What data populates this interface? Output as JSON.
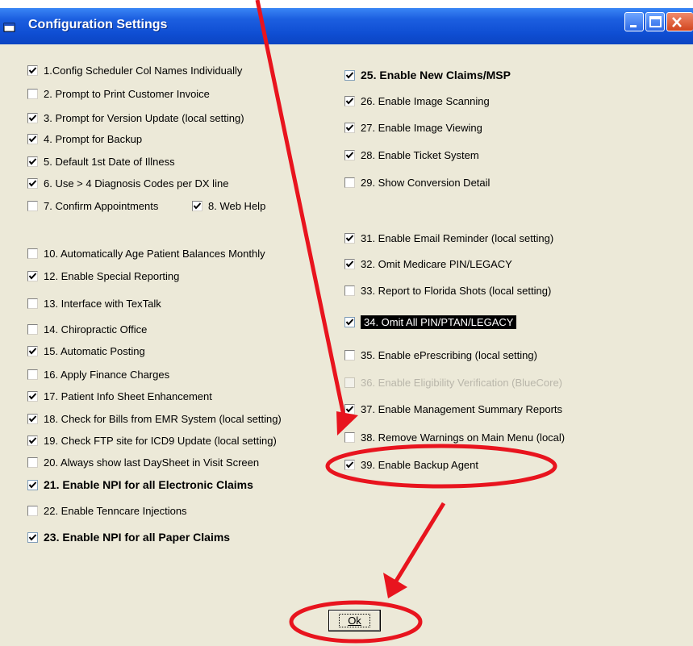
{
  "window": {
    "title": "Configuration Settings"
  },
  "options": [
    {
      "id": "o1",
      "label": "1.Config Scheduler Col Names Individually",
      "checked": true
    },
    {
      "id": "o2",
      "label": "2. Prompt to Print Customer Invoice",
      "checked": false
    },
    {
      "id": "o3",
      "label": "3. Prompt for Version Update (local setting)",
      "checked": true
    },
    {
      "id": "o4",
      "label": "4. Prompt for Backup",
      "checked": true
    },
    {
      "id": "o5",
      "label": "5. Default 1st Date of Illness",
      "checked": true
    },
    {
      "id": "o6",
      "label": "6. Use > 4 Diagnosis Codes per DX line",
      "checked": true
    },
    {
      "id": "o7",
      "label": "7. Confirm Appointments",
      "checked": false
    },
    {
      "id": "o8",
      "label": "8. Web Help",
      "checked": true
    },
    {
      "id": "o10",
      "label": "10. Automatically Age Patient Balances Monthly",
      "checked": false
    },
    {
      "id": "o12",
      "label": "12.  Enable Special Reporting",
      "checked": true
    },
    {
      "id": "o13",
      "label": "13. Interface with TexTalk",
      "checked": false
    },
    {
      "id": "o14",
      "label": "14. Chiropractic Office",
      "checked": false
    },
    {
      "id": "o15",
      "label": "15. Automatic Posting",
      "checked": true
    },
    {
      "id": "o16",
      "label": "16. Apply Finance Charges",
      "checked": false
    },
    {
      "id": "o17",
      "label": "17. Patient Info Sheet Enhancement",
      "checked": true
    },
    {
      "id": "o18",
      "label": "18. Check for  Bills from EMR System (local setting)",
      "checked": true
    },
    {
      "id": "o19",
      "label": "19. Check FTP site for ICD9 Update (local setting)",
      "checked": true
    },
    {
      "id": "o20",
      "label": "20. Always show last DaySheet in Visit Screen",
      "checked": false
    },
    {
      "id": "o21",
      "label": "21.  Enable NPI for all Electronic Claims",
      "checked": true
    },
    {
      "id": "o22",
      "label": "22.  Enable Tenncare Injections",
      "checked": false
    },
    {
      "id": "o23",
      "label": "23.  Enable NPI for all Paper Claims",
      "checked": true
    },
    {
      "id": "o25",
      "label": "25.  Enable New Claims/MSP",
      "checked": true
    },
    {
      "id": "o26",
      "label": "26. Enable Image Scanning",
      "checked": true
    },
    {
      "id": "o27",
      "label": "27.  Enable Image Viewing",
      "checked": true
    },
    {
      "id": "o28",
      "label": "28.  Enable Ticket System",
      "checked": true
    },
    {
      "id": "o29",
      "label": "29. Show Conversion Detail",
      "checked": false
    },
    {
      "id": "o31",
      "label": "31. Enable Email Reminder (local setting)",
      "checked": true
    },
    {
      "id": "o32",
      "label": "32. Omit Medicare PIN/LEGACY",
      "checked": true
    },
    {
      "id": "o33",
      "label": "33. Report to Florida Shots (local setting)",
      "checked": false
    },
    {
      "id": "o34",
      "label": "34. Omit All PIN/PTAN/LEGACY",
      "checked": true
    },
    {
      "id": "o35",
      "label": "35.  Enable ePrescribing (local setting)",
      "checked": false
    },
    {
      "id": "o36",
      "label": "36.  Enable Eligibility Verification (BlueCore)",
      "checked": false
    },
    {
      "id": "o37",
      "label": "37.  Enable Management Summary Reports",
      "checked": true
    },
    {
      "id": "o38",
      "label": "38.  Remove Warnings on Main Menu (local)",
      "checked": false
    },
    {
      "id": "o39",
      "label": "39.  Enable Backup Agent",
      "checked": true
    }
  ],
  "ok_button": {
    "label": "Ok"
  },
  "annotation": {
    "color": "#e8141e"
  }
}
